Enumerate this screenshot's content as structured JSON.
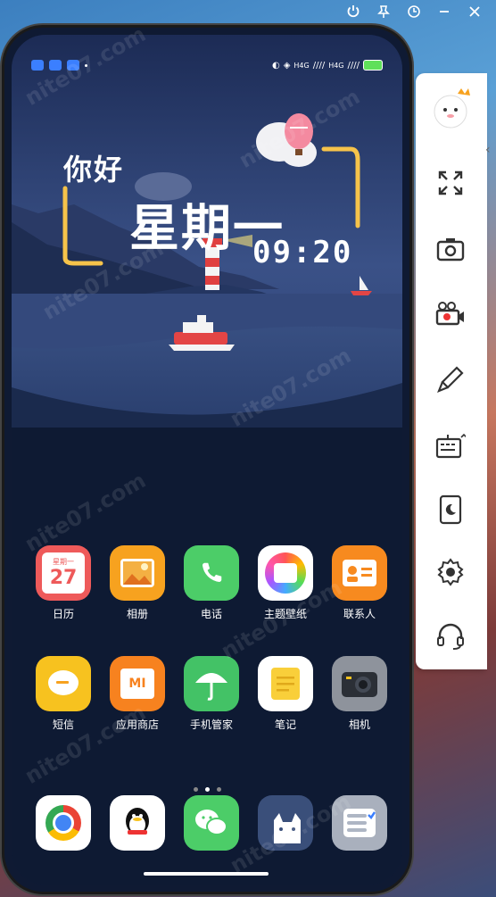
{
  "window_controls": {
    "power_icon": "power-icon",
    "pin_icon": "pin-icon",
    "clock_icon": "clock-icon",
    "minimize_icon": "minimize-icon",
    "close_icon": "close-icon"
  },
  "status_bar": {
    "network_left": "H4G",
    "network_right": "H4G"
  },
  "widget": {
    "greeting": "你好",
    "weekday": "星期一",
    "time": "09:20"
  },
  "apps_row1": [
    {
      "label": "日历",
      "icon": "calendar-icon",
      "color": "#ee5a5a",
      "top_text": "星期一",
      "date": "27"
    },
    {
      "label": "相册",
      "icon": "gallery-icon",
      "color": "#f7a21f"
    },
    {
      "label": "电话",
      "icon": "phone-icon",
      "color": "#4ccd68"
    },
    {
      "label": "主题壁纸",
      "icon": "theme-icon",
      "color": "#ffffff"
    },
    {
      "label": "联系人",
      "icon": "contacts-icon",
      "color": "#f78a1f"
    }
  ],
  "apps_row2": [
    {
      "label": "短信",
      "icon": "message-icon",
      "color": "#f7c21f"
    },
    {
      "label": "应用商店",
      "icon": "store-icon",
      "color": "#f7821f",
      "mark": "MI"
    },
    {
      "label": "手机管家",
      "icon": "security-icon",
      "color": "#43c266"
    },
    {
      "label": "笔记",
      "icon": "notes-icon",
      "color": "#ffffff"
    },
    {
      "label": "相机",
      "icon": "camera-icon",
      "color": "#8e939c"
    }
  ],
  "dock": [
    {
      "icon": "chrome-icon",
      "color": "#ffffff"
    },
    {
      "icon": "qq-icon",
      "color": "#ffffff"
    },
    {
      "icon": "wechat-icon",
      "color": "#4ccd68"
    },
    {
      "icon": "cat-app-icon",
      "color": "#3a4f7a"
    },
    {
      "icon": "checklist-icon",
      "color": "#a9b0bd"
    }
  ],
  "side_toolbar": [
    {
      "icon": "fullscreen-icon"
    },
    {
      "icon": "screenshot-icon"
    },
    {
      "icon": "record-icon"
    },
    {
      "icon": "brush-icon"
    },
    {
      "icon": "keyboard-icon"
    },
    {
      "icon": "phone-moon-icon"
    },
    {
      "icon": "settings-icon"
    },
    {
      "icon": "headset-icon"
    }
  ],
  "watermark": "nite07.com"
}
